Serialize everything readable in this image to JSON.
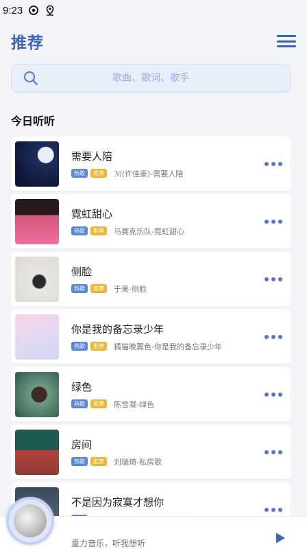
{
  "status": {
    "time": "9:23"
  },
  "header": {
    "title": "推荐"
  },
  "search": {
    "placeholder": "歌曲、歌词、歌手"
  },
  "section": {
    "title": "今日听听"
  },
  "tags": {
    "t1": "热歌",
    "t2": "推荐"
  },
  "songs": [
    {
      "title": "需要人陪",
      "artist": "ℳ(许佳豪)-需要人陪"
    },
    {
      "title": "霓虹甜心",
      "artist": "马赛克乐队-霓虹甜心"
    },
    {
      "title": "侧脸",
      "artist": "于果-侧脸"
    },
    {
      "title": "你是我的备忘录少年",
      "artist": "橘猫晚翼色-你是我的备忘录少年"
    },
    {
      "title": "绿色",
      "artist": "陈雪凝-绿色"
    },
    {
      "title": "房间",
      "artist": "刘瑞琦-私房歌"
    },
    {
      "title": "不是因为寂寞才想你",
      "artist": "王小帅-不是因为寂寞才想你"
    }
  ],
  "player": {
    "text": "重力音乐，听我想听"
  },
  "colors": {
    "accent": "#3d63b8",
    "tag_blue": "#5a86d4",
    "tag_yellow": "#e7b83a"
  },
  "icons": [
    "sync-icon",
    "location-icon",
    "menu-icon",
    "search-icon",
    "more-icon",
    "play-icon",
    "disc-icon"
  ]
}
